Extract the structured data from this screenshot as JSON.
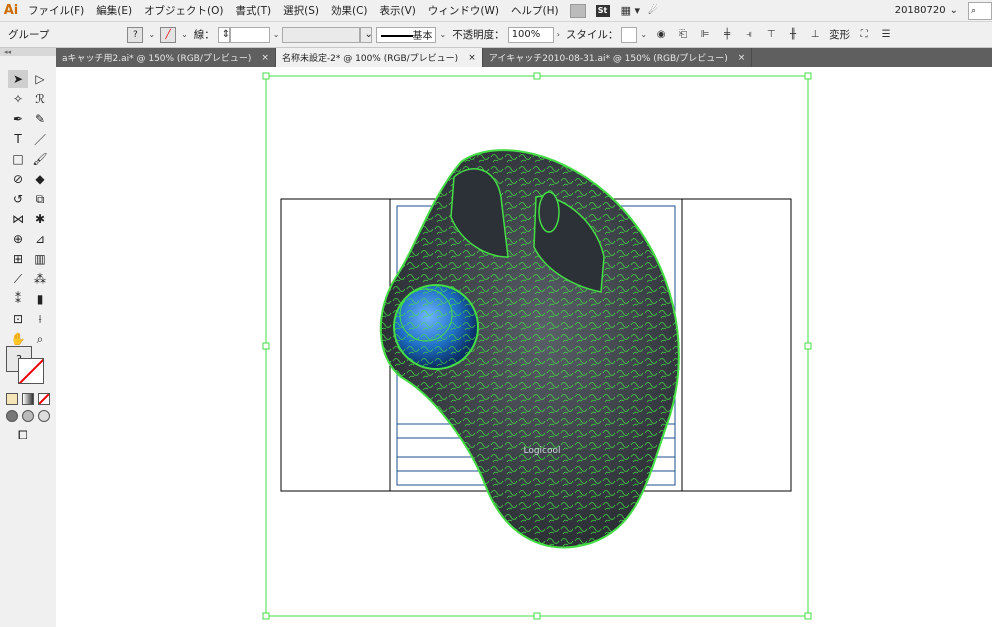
{
  "app": {
    "logo": "Ai"
  },
  "menu": [
    "ファイル(F)",
    "編集(E)",
    "オブジェクト(O)",
    "書式(T)",
    "選択(S)",
    "効果(C)",
    "表示(V)",
    "ウィンドウ(W)",
    "ヘルプ(H)"
  ],
  "menu_icons": {
    "bridge": "Br",
    "stock": "St"
  },
  "workspace": "20180720",
  "control": {
    "selection": "グループ",
    "fill_value": "?",
    "stroke_label": "線：",
    "stroke_style": "基本",
    "opacity_label": "不透明度：",
    "opacity": "100%",
    "style_label": "スタイル：",
    "transform_label": "変形"
  },
  "tabs": [
    {
      "label": "aキャッチ用2.ai* @ 150% (RGB/プレビュー)",
      "active": false
    },
    {
      "label": "名称未設定-2* @ 100% (RGB/プレビュー)",
      "active": true
    },
    {
      "label": "アイキャッチ2010-08-31.ai* @ 150% (RGB/プレビュー)",
      "active": false
    }
  ],
  "tabs_close": "×",
  "toolbar": {
    "fill_value": "?"
  },
  "canvas": {
    "colors": {
      "selection": "#44dd44",
      "artboard_line": "#1f4f8f",
      "sphere": "#1e6fc4",
      "body": "#3a4048"
    },
    "logo_text": "Logicool"
  }
}
